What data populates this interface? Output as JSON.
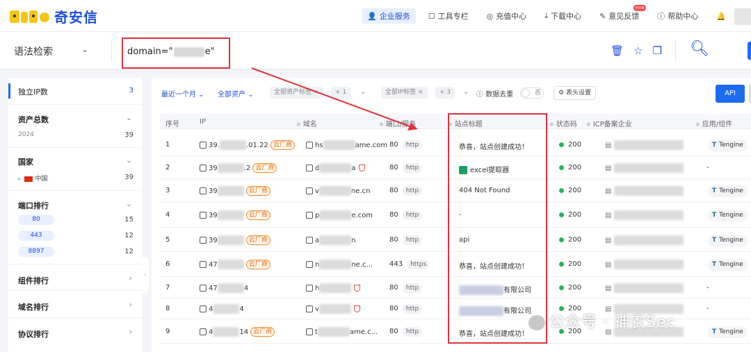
{
  "brand": {
    "name": "奇安信"
  },
  "nav": [
    {
      "label": "企业服务",
      "icon": "user-icon",
      "active": true
    },
    {
      "label": "工具专栏",
      "icon": "toolbox-icon"
    },
    {
      "label": "充值中心",
      "icon": "coin-icon"
    },
    {
      "label": "下载中心",
      "icon": "download-icon"
    },
    {
      "label": "意见反馈",
      "icon": "feedback-icon",
      "badge": "new"
    },
    {
      "label": "帮助中心",
      "icon": "help-icon"
    }
  ],
  "search": {
    "mode": "语法检索",
    "query_prefix": "domain=\"",
    "query_suffix": "e\""
  },
  "sidebar": {
    "unique_ip": {
      "label": "独立IP数",
      "count": "3"
    },
    "total_assets": {
      "label": "资产总数",
      "sub": "2024",
      "count": "39"
    },
    "country": {
      "label": "国家",
      "item": "中国",
      "count": "39"
    },
    "ports": {
      "label": "端口排行",
      "items": [
        {
          "port": "80",
          "count": "15"
        },
        {
          "port": "443",
          "count": "12"
        },
        {
          "port": "8897",
          "count": "12"
        }
      ]
    },
    "components": {
      "label": "组件排行"
    },
    "domains": {
      "label": "域名排行"
    },
    "protocols": {
      "label": "协议排行"
    }
  },
  "filters": {
    "time": "最近一个月",
    "assets": "全部资产",
    "asset_tags": "全部资产标签",
    "asset_tags_more": "+ 1",
    "ip_tags": "全部IP标签",
    "ip_tags_more": "+ 3",
    "dedupe": "数据去重",
    "dedupe_state": "否",
    "header_settings": "表头设置",
    "api": "API"
  },
  "columns": {
    "index": "序号",
    "ip": "IP",
    "domain": "域名",
    "port": "端口/服务",
    "title": "站点标题",
    "status": "状态码",
    "icp": "ICP备案企业",
    "app": "应用/组件"
  },
  "rows": [
    {
      "index": "1",
      "ip_prefix": "39.",
      "ip_suffix": ".01.22",
      "cloud": "云厂商",
      "domain_prefix": "hs",
      "domain_suffix": "ame.com",
      "port": "80",
      "proto": "http",
      "title": "恭喜，站点创建成功！",
      "status": "200",
      "app": "Tengine"
    },
    {
      "index": "2",
      "ip_prefix": "39",
      "ip_suffix": ".2",
      "cloud": "云厂商",
      "domain_prefix": "d",
      "domain_suffix": "a",
      "shield": true,
      "port": "80",
      "proto": "http",
      "title": "excel提取器",
      "title_icon": "excel-icon",
      "status": "200",
      "app": "-"
    },
    {
      "index": "3",
      "ip_prefix": "39",
      "ip_suffix": "",
      "cloud": "云厂商",
      "domain_prefix": "v",
      "domain_suffix": "ne.cn",
      "port": "80",
      "proto": "http",
      "title": "404 Not Found",
      "status": "200",
      "app": "Tengine"
    },
    {
      "index": "4",
      "ip_prefix": "39",
      "ip_suffix": "",
      "cloud": "云厂商",
      "domain_prefix": "p",
      "domain_suffix": "e.com",
      "port": "80",
      "proto": "http",
      "title": "-",
      "status": "200",
      "app": "Tengine"
    },
    {
      "index": "5",
      "ip_prefix": "39",
      "ip_suffix": "",
      "cloud": "云厂商",
      "domain_prefix": "a",
      "domain_suffix": "n",
      "port": "80",
      "proto": "http",
      "title": "api",
      "status": "200",
      "app": "Tengine"
    },
    {
      "index": "6",
      "ip_prefix": "47",
      "ip_suffix": "",
      "cloud": "云厂商",
      "domain_prefix": "n",
      "domain_suffix": "ne.c...",
      "port": "443",
      "proto": "https",
      "title": "恭喜，站点创建成功！",
      "status": "200",
      "app": "Tengine"
    },
    {
      "index": "7",
      "ip_prefix": "47",
      "ip_suffix": "4",
      "cloud": "",
      "domain_prefix": "h",
      "domain_suffix": "",
      "shield": true,
      "port": "80",
      "proto": "http",
      "title": "有限公司",
      "title_blur": true,
      "status": "200",
      "app": "-"
    },
    {
      "index": "8",
      "ip_prefix": "4",
      "ip_suffix": "4",
      "cloud": "",
      "domain_prefix": "v",
      "domain_suffix": "",
      "shield": true,
      "port": "80",
      "proto": "http",
      "title": "有限公司",
      "title_blur": true,
      "status": "200",
      "app": "-"
    },
    {
      "index": "9",
      "ip_prefix": "4",
      "ip_suffix": "14",
      "cloud": "云厂商",
      "domain_prefix": "t",
      "domain_suffix": "ame.c...",
      "port": "80",
      "proto": "http",
      "title": "恭喜，站点创建成功！",
      "status": "200",
      "app": "Tengine"
    }
  ],
  "watermark": "公众号 · 神农Sec",
  "colors": {
    "accent": "#1d6cf0",
    "annotation": "#e0313a",
    "cloud_tag": "#f06c00",
    "status_ok": "#23b55d"
  }
}
